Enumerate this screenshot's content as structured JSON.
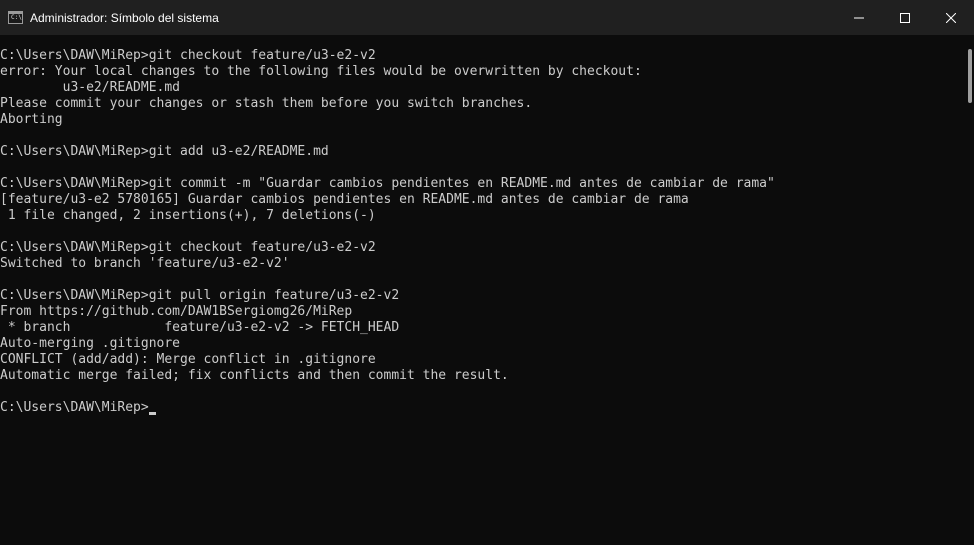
{
  "window": {
    "title": "Administrador: Símbolo del sistema",
    "icon": "cmd-icon",
    "controls": [
      "minimize-icon",
      "maximize-icon",
      "close-icon"
    ]
  },
  "console": {
    "lines": [
      "C:\\Users\\DAW\\MiRep>git checkout feature/u3-e2-v2",
      "error: Your local changes to the following files would be overwritten by checkout:",
      "        u3-e2/README.md",
      "Please commit your changes or stash them before you switch branches.",
      "Aborting",
      "",
      "C:\\Users\\DAW\\MiRep>git add u3-e2/README.md",
      "",
      "C:\\Users\\DAW\\MiRep>git commit -m \"Guardar cambios pendientes en README.md antes de cambiar de rama\"",
      "[feature/u3-e2 5780165] Guardar cambios pendientes en README.md antes de cambiar de rama",
      " 1 file changed, 2 insertions(+), 7 deletions(-)",
      "",
      "C:\\Users\\DAW\\MiRep>git checkout feature/u3-e2-v2",
      "Switched to branch 'feature/u3-e2-v2'",
      "",
      "C:\\Users\\DAW\\MiRep>git pull origin feature/u3-e2-v2",
      "From https://github.com/DAW1BSergiomg26/MiRep",
      " * branch            feature/u3-e2-v2 -> FETCH_HEAD",
      "Auto-merging .gitignore",
      "CONFLICT (add/add): Merge conflict in .gitignore",
      "Automatic merge failed; fix conflicts and then commit the result.",
      ""
    ],
    "prompt": "C:\\Users\\DAW\\MiRep>"
  },
  "colors": {
    "background": "#0c0c0c",
    "titlebar": "#202020",
    "text": "#cccccc"
  }
}
